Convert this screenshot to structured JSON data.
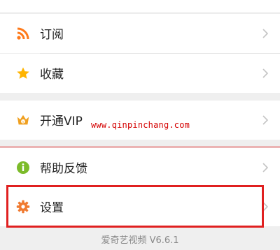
{
  "menu": {
    "subscribe": {
      "label": "订阅",
      "icon": "rss-icon",
      "color": "#ff7a1a"
    },
    "favorites": {
      "label": "收藏",
      "icon": "star-icon",
      "color": "#ffb400"
    },
    "vip": {
      "label": "开通VIP",
      "icon": "crown-vip-icon",
      "color": "#f0a020"
    },
    "feedback": {
      "label": "帮助反馈",
      "icon": "info-icon",
      "color": "#7cbb2a"
    },
    "settings": {
      "label": "设置",
      "icon": "gear-icon",
      "color": "#f07a30"
    }
  },
  "watermark": "www.qinpinchang.com",
  "footer": {
    "version": "爱奇艺视频 V6.6.1"
  },
  "colors": {
    "highlight": "#e02020",
    "chevron": "#c4c4c4",
    "background": "#efefef"
  }
}
